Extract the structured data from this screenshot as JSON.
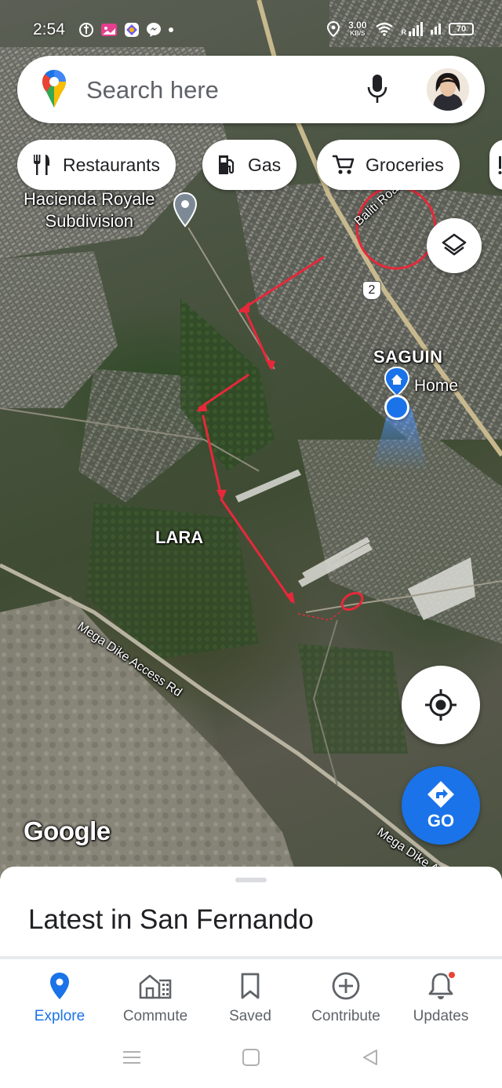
{
  "status_bar": {
    "time": "2:54",
    "speed_value": "3.00",
    "speed_unit": "KB/S",
    "roaming": "R",
    "battery": "70"
  },
  "search": {
    "placeholder": "Search here"
  },
  "chips": [
    {
      "label": "Restaurants",
      "icon": "fork-knife-icon"
    },
    {
      "label": "Gas",
      "icon": "gas-pump-icon"
    },
    {
      "label": "Groceries",
      "icon": "cart-icon"
    }
  ],
  "map": {
    "places": {
      "hacienda_line1": "Hacienda Royale",
      "hacienda_line2": "Subdivision",
      "saguin": "SAGUIN",
      "home": "Home",
      "lara": "LARA",
      "baliti": "Baliti Road",
      "road_shield": "2",
      "mega_dike_1": "Mega Dike Access Rd",
      "mega_dike_2": "Mega Dike A"
    },
    "attribution": "Google",
    "colors": {
      "annotation_red": "#e8283a",
      "route_blue": "#1a73e8"
    }
  },
  "fab": {
    "go_label": "GO"
  },
  "sheet": {
    "title": "Latest in San Fernando"
  },
  "nav": {
    "items": [
      {
        "label": "Explore",
        "icon": "explore-pin-icon",
        "active": true
      },
      {
        "label": "Commute",
        "icon": "commute-icon",
        "active": false
      },
      {
        "label": "Saved",
        "icon": "bookmark-icon",
        "active": false
      },
      {
        "label": "Contribute",
        "icon": "plus-circle-icon",
        "active": false
      },
      {
        "label": "Updates",
        "icon": "bell-icon",
        "active": false
      }
    ]
  }
}
